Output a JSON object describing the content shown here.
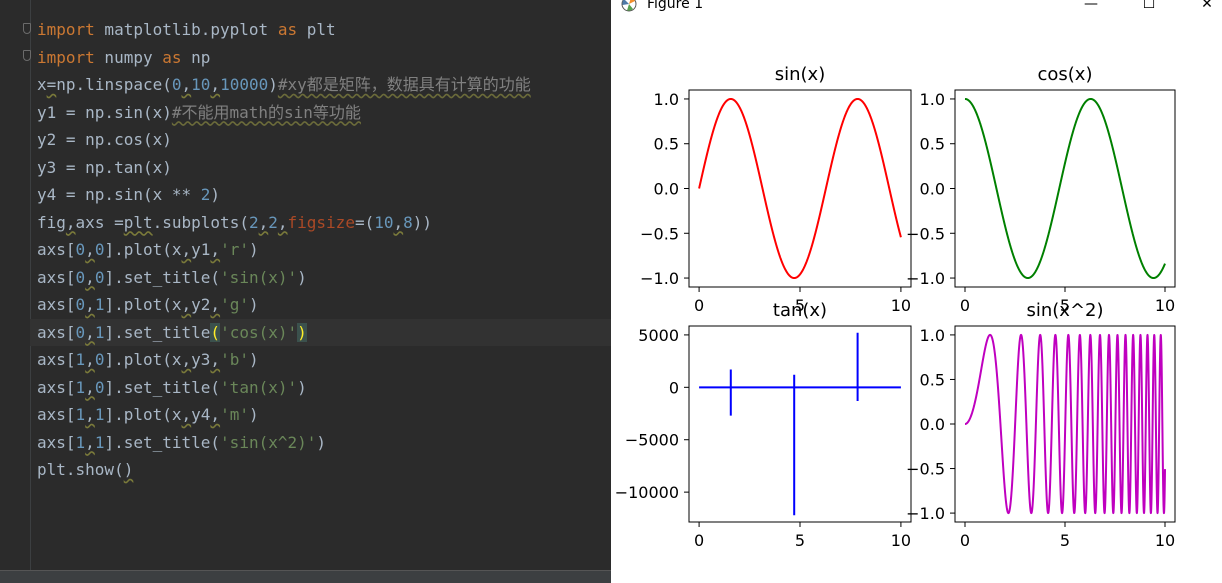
{
  "editor": {
    "lines": [
      [
        [
          "kw",
          "import"
        ],
        [
          "p",
          " matplotlib.pyplot "
        ],
        [
          "kw",
          "as"
        ],
        [
          "p",
          " plt"
        ]
      ],
      [
        [
          "kw",
          "import"
        ],
        [
          "p",
          " numpy "
        ],
        [
          "kw",
          "as"
        ],
        [
          "p",
          " np"
        ]
      ],
      [
        [
          "p",
          "x"
        ],
        [
          "wavy",
          "="
        ],
        [
          "p",
          "np.linspace("
        ],
        [
          "num",
          "0"
        ],
        [
          "wavy",
          ","
        ],
        [
          "num",
          "10"
        ],
        [
          "wavy",
          ","
        ],
        [
          "num",
          "10000"
        ],
        [
          "p",
          ")"
        ],
        [
          "cmt",
          "#xy都是矩阵，数据具有计算的功能"
        ]
      ],
      [
        [
          "p",
          "y1 = np.sin(x)"
        ],
        [
          "cmt",
          "#不能用math的sin等功能"
        ]
      ],
      [
        [
          "p",
          "y2 = np.cos(x)"
        ]
      ],
      [
        [
          "p",
          "y3 = np.tan(x)"
        ]
      ],
      [
        [
          "p",
          "y4 = np.sin(x ** "
        ],
        [
          "num",
          "2"
        ],
        [
          "p",
          ")"
        ]
      ],
      [
        [
          "p",
          "fig"
        ],
        [
          "wavy",
          ","
        ],
        [
          "p",
          "axs ="
        ],
        [
          "wavy",
          "plt"
        ],
        [
          "p",
          ".subplots("
        ],
        [
          "num",
          "2"
        ],
        [
          "wavy",
          ","
        ],
        [
          "num",
          "2"
        ],
        [
          "wavy",
          ","
        ],
        [
          "param",
          "figsize"
        ],
        [
          "p",
          "=("
        ],
        [
          "num",
          "10"
        ],
        [
          "wavy",
          ","
        ],
        [
          "num",
          "8"
        ],
        [
          "p",
          "))"
        ]
      ],
      [
        [
          "p",
          "axs["
        ],
        [
          "num",
          "0"
        ],
        [
          "wavy",
          ","
        ],
        [
          "num",
          "0"
        ],
        [
          "p",
          "].plot(x"
        ],
        [
          "wavy",
          ","
        ],
        [
          "p",
          "y1"
        ],
        [
          "wavy",
          ","
        ],
        [
          "str",
          "'r'"
        ],
        [
          "p",
          ")"
        ]
      ],
      [
        [
          "p",
          "axs["
        ],
        [
          "num",
          "0"
        ],
        [
          "wavy",
          ","
        ],
        [
          "num",
          "0"
        ],
        [
          "p",
          "].set_title("
        ],
        [
          "str",
          "'sin(x)'"
        ],
        [
          "p",
          ")"
        ]
      ],
      [
        [
          "p",
          "axs["
        ],
        [
          "num",
          "0"
        ],
        [
          "wavy",
          ","
        ],
        [
          "num",
          "1"
        ],
        [
          "p",
          "].plot(x"
        ],
        [
          "wavy",
          ","
        ],
        [
          "p",
          "y2"
        ],
        [
          "wavy",
          ","
        ],
        [
          "str",
          "'g'"
        ],
        [
          "p",
          ")"
        ]
      ],
      [
        [
          "p",
          "axs["
        ],
        [
          "num",
          "0"
        ],
        [
          "wavy",
          ","
        ],
        [
          "num",
          "1"
        ],
        [
          "p",
          "].set_title"
        ],
        [
          "hl",
          "("
        ],
        [
          "str",
          "'cos(x)'"
        ],
        [
          "hl",
          ")"
        ]
      ],
      [
        [
          "p",
          "axs["
        ],
        [
          "num",
          "1"
        ],
        [
          "wavy",
          ","
        ],
        [
          "num",
          "0"
        ],
        [
          "p",
          "].plot(x"
        ],
        [
          "wavy",
          ","
        ],
        [
          "p",
          "y3"
        ],
        [
          "wavy",
          ","
        ],
        [
          "str",
          "'b'"
        ],
        [
          "p",
          ")"
        ]
      ],
      [
        [
          "p",
          "axs["
        ],
        [
          "num",
          "1"
        ],
        [
          "wavy",
          ","
        ],
        [
          "num",
          "0"
        ],
        [
          "p",
          "].set_title("
        ],
        [
          "str",
          "'tan(x)'"
        ],
        [
          "p",
          ")"
        ]
      ],
      [
        [
          "p",
          "axs["
        ],
        [
          "num",
          "1"
        ],
        [
          "wavy",
          ","
        ],
        [
          "num",
          "1"
        ],
        [
          "p",
          "].plot(x"
        ],
        [
          "wavy",
          ","
        ],
        [
          "p",
          "y4"
        ],
        [
          "wavy",
          ","
        ],
        [
          "str",
          "'m'"
        ],
        [
          "p",
          ")"
        ]
      ],
      [
        [
          "p",
          "axs["
        ],
        [
          "num",
          "1"
        ],
        [
          "wavy",
          ","
        ],
        [
          "num",
          "1"
        ],
        [
          "p",
          "].set_title("
        ],
        [
          "str",
          "'sin(x^2)'"
        ],
        [
          "p",
          ")"
        ]
      ],
      [
        [
          "p",
          "plt.show("
        ],
        [
          "wavy",
          ")"
        ]
      ]
    ],
    "current_line": 11
  },
  "window": {
    "title": "Figure 1",
    "minimize_glyph": "—",
    "maximize_glyph": "☐",
    "close_glyph": "✕",
    "icon": "matplotlib-icon"
  },
  "chart_data": [
    {
      "type": "line",
      "title": "sin(x)",
      "function": "sin(x)",
      "color": "#ff0000",
      "xlim": [
        0,
        10
      ],
      "ylim": [
        -1,
        1
      ],
      "xticks": [
        "0",
        "5",
        "10"
      ],
      "yticks": [
        "1.0",
        "0.5",
        "0.0",
        "−0.5",
        "−1.0"
      ]
    },
    {
      "type": "line",
      "title": "cos(x)",
      "function": "cos(x)",
      "color": "#008000",
      "xlim": [
        0,
        10
      ],
      "ylim": [
        -1,
        1
      ],
      "xticks": [
        "0",
        "5",
        "10"
      ],
      "yticks": [
        "1.0",
        "0.5",
        "0.0",
        "−0.5",
        "−1.0"
      ]
    },
    {
      "type": "line",
      "title": "tan(x)",
      "function": "tan(x)",
      "color": "#0000ff",
      "xlim": [
        0,
        10
      ],
      "ylim": [
        -12000,
        5000
      ],
      "spikes": [
        {
          "x": 1.5708,
          "min": -2700,
          "max": 1700
        },
        {
          "x": 4.7124,
          "min": -12200,
          "max": 1200
        },
        {
          "x": 7.854,
          "min": -1300,
          "max": 5200
        }
      ],
      "xticks": [
        "0",
        "5",
        "10"
      ],
      "yticks": [
        "5000",
        "0",
        "−5000",
        "−10000"
      ]
    },
    {
      "type": "line",
      "title": "sin(x^2)",
      "function": "sin(x^2)",
      "color": "#bf00bf",
      "xlim": [
        0,
        10
      ],
      "ylim": [
        -1,
        1
      ],
      "xticks": [
        "0",
        "5",
        "10"
      ],
      "yticks": [
        "1.0",
        "0.5",
        "0.0",
        "−0.5",
        "−1.0"
      ]
    }
  ]
}
